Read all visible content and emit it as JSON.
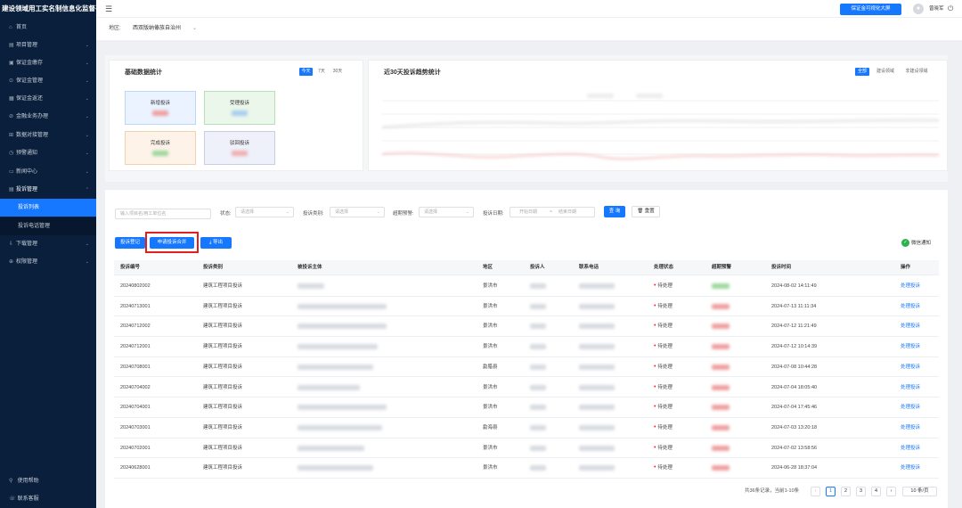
{
  "app_title": "建设领域用工实名制信息化监督平台",
  "sidebar": {
    "items": [
      {
        "icon": "⌂",
        "label": "首页",
        "arrow": false
      },
      {
        "icon": "▤",
        "label": "项目管理",
        "arrow": true
      },
      {
        "icon": "▣",
        "label": "保证金缴存",
        "arrow": true
      },
      {
        "icon": "⊙",
        "label": "保证金管理",
        "arrow": true
      },
      {
        "icon": "▦",
        "label": "保证金返还",
        "arrow": true
      },
      {
        "icon": "⊘",
        "label": "金融业务办理",
        "arrow": true
      },
      {
        "icon": "⊞",
        "label": "数据对接管理",
        "arrow": true
      },
      {
        "icon": "◷",
        "label": "预警通知",
        "arrow": true
      },
      {
        "icon": "▭",
        "label": "新闻中心",
        "arrow": true
      },
      {
        "icon": "▤",
        "label": "投诉管理",
        "arrow": true
      },
      {
        "icon": "",
        "label": "投诉列表",
        "arrow": false
      },
      {
        "icon": "",
        "label": "投诉电话管理",
        "arrow": false
      },
      {
        "icon": "⇩",
        "label": "下载管理",
        "arrow": true
      },
      {
        "icon": "⊕",
        "label": "权限管理",
        "arrow": true
      }
    ],
    "bottom": [
      {
        "icon": "⚲",
        "label": "使用帮助"
      },
      {
        "icon": "☏",
        "label": "联系客服"
      }
    ]
  },
  "header": {
    "menu_icon": "☰",
    "bigscreen_label": "保证金可视化大屏",
    "avatar_icon": "user-icon",
    "user_name": "曾晓军",
    "power_icon": "⏻"
  },
  "region": {
    "label": "地区:",
    "value": "西双版纳傣族自治州",
    "chevron": "⌄"
  },
  "basic_stats": {
    "title": "基础数据统计",
    "periods": [
      "今天",
      "7天",
      "30天"
    ],
    "active_period": "今天",
    "boxes": [
      {
        "label": "新增投诉",
        "bg": "#eaf3ff",
        "border": "#bcd6f5",
        "blur": "#f0a0a0"
      },
      {
        "label": "受理投诉",
        "bg": "#eaf7ea",
        "border": "#b7dfb7",
        "blur": "#a8cdf0"
      },
      {
        "label": "完成投诉",
        "bg": "#fdf3e8",
        "border": "#f2d2ad",
        "blur": "#9fd89f"
      },
      {
        "label": "驳回投诉",
        "bg": "#eef0fa",
        "border": "#c8cde8",
        "blur": "#f0b0b0"
      }
    ]
  },
  "trend": {
    "title": "近30天投诉趋势统计",
    "tabs": [
      "全部",
      "建设领域",
      "非建设领域"
    ],
    "active_tab": "全部"
  },
  "filters": {
    "search_placeholder": "输入项目名/用工单位名",
    "status_label": "状态:",
    "status_placeholder": "请选择",
    "type_label": "投诉类别:",
    "type_placeholder": "请选择",
    "overdue_label": "超期预警:",
    "overdue_placeholder": "请选择",
    "date_label": "投诉日期:",
    "date_start": "开始日期",
    "date_sep": "~",
    "date_end": "结束日期",
    "query_label": "查 询",
    "reset_label": "重置"
  },
  "actions": {
    "register_label": "投诉登记",
    "merge_label": "申请投诉合并",
    "export_label": "导出",
    "wechat_label": "微信通知"
  },
  "table": {
    "columns": [
      "投诉编号",
      "投诉类别",
      "被投诉主体",
      "地区",
      "投诉人",
      "联系电话",
      "处理状态",
      "超期预警",
      "投诉时间",
      "操作"
    ],
    "rows": [
      {
        "id": "20240802002",
        "type": "建筑工程项目投诉",
        "region": "景洪市",
        "status": "待处理",
        "time": "2024-08-02 14:11:49",
        "op": "处理投诉",
        "subject_w": 30,
        "warn": "#9ed89e"
      },
      {
        "id": "20240713001",
        "type": "建筑工程项目投诉",
        "region": "景洪市",
        "status": "待处理",
        "time": "2024-07-13 11:11:34",
        "op": "处理投诉",
        "subject_w": 100,
        "warn": "#f0a0a0"
      },
      {
        "id": "20240712002",
        "type": "建筑工程项目投诉",
        "region": "景洪市",
        "status": "待处理",
        "time": "2024-07-12 11:21:49",
        "op": "处理投诉",
        "subject_w": 100,
        "warn": "#f0a0a0"
      },
      {
        "id": "20240712001",
        "type": "建筑工程项目投诉",
        "region": "景洪市",
        "status": "待处理",
        "time": "2024-07-12 10:14:39",
        "op": "处理投诉",
        "subject_w": 90,
        "warn": "#f0a0a0"
      },
      {
        "id": "20240708001",
        "type": "建筑工程项目投诉",
        "region": "勐腊县",
        "status": "待处理",
        "time": "2024-07-08 10:44:28",
        "op": "处理投诉",
        "subject_w": 85,
        "warn": "#f0a0a0"
      },
      {
        "id": "20240704002",
        "type": "建筑工程项目投诉",
        "region": "景洪市",
        "status": "待处理",
        "time": "2024-07-04 18:05:40",
        "op": "处理投诉",
        "subject_w": 70,
        "warn": "#f0a0a0"
      },
      {
        "id": "20240704001",
        "type": "建筑工程项目投诉",
        "region": "景洪市",
        "status": "待处理",
        "time": "2024-07-04 17:45:46",
        "op": "处理投诉",
        "subject_w": 100,
        "warn": "#f0a0a0"
      },
      {
        "id": "20240703001",
        "type": "建筑工程项目投诉",
        "region": "勐海县",
        "status": "待处理",
        "time": "2024-07-03 13:20:18",
        "op": "处理投诉",
        "subject_w": 95,
        "warn": "#f0a0a0"
      },
      {
        "id": "20240702001",
        "type": "建筑工程项目投诉",
        "region": "景洪市",
        "status": "待处理",
        "time": "2024-07-02 13:58:56",
        "op": "处理投诉",
        "subject_w": 75,
        "warn": "#f0a0a0"
      },
      {
        "id": "20240628001",
        "type": "建筑工程项目投诉",
        "region": "景洪市",
        "status": "待处理",
        "time": "2024-06-28 18:37:04",
        "op": "处理投诉",
        "subject_w": 85,
        "warn": "#f0a0a0"
      }
    ]
  },
  "pagination": {
    "summary": "共36条记录，当前1-10条",
    "prev": "‹",
    "pages": [
      "1",
      "2",
      "3",
      "4"
    ],
    "current": "1",
    "next": "›",
    "page_size": "10 条/页"
  },
  "colors": {
    "primary": "#1677ff",
    "sidebar_bg": "#0a1f3b",
    "danger": "#f5222d",
    "wechat": "#2bb24c",
    "highlight_box": "#e02020"
  }
}
